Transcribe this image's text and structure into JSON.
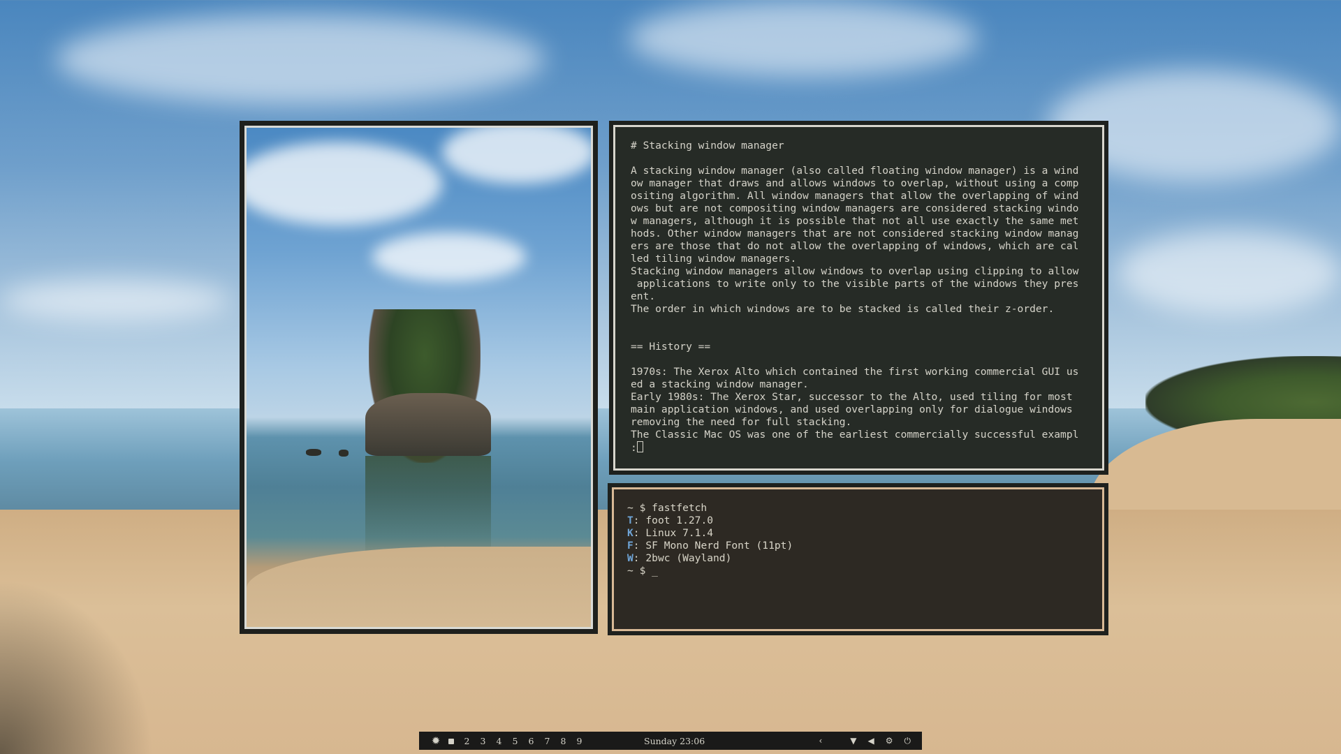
{
  "text_viewer": {
    "lines": [
      "# Stacking window manager",
      "",
      "A stacking window manager (also called floating window manager) is a wind",
      "ow manager that draws and allows windows to overlap, without using a comp",
      "ositing algorithm. All window managers that allow the overlapping of wind",
      "ows but are not compositing window managers are considered stacking windo",
      "w managers, although it is possible that not all use exactly the same met",
      "hods. Other window managers that are not considered stacking window manag",
      "ers are those that do not allow the overlapping of windows, which are cal",
      "led tiling window managers.",
      "Stacking window managers allow windows to overlap using clipping to allow",
      " applications to write only to the visible parts of the windows they pres",
      "ent.",
      "The order in which windows are to be stacked is called their z-order.",
      "",
      "",
      "== History ==",
      "",
      "1970s: The Xerox Alto which contained the first working commercial GUI us",
      "ed a stacking window manager.",
      "Early 1980s: The Xerox Star, successor to the Alto, used tiling for most",
      "main application windows, and used overlapping only for dialogue windows",
      "removing the need for full stacking.",
      "The Classic Mac OS was one of the earliest commercially successful exampl"
    ],
    "prompt": ":"
  },
  "terminal": {
    "command_line": "~ $ fastfetch",
    "info": [
      {
        "key": "T",
        "value": ": foot 1.27.0"
      },
      {
        "key": "K",
        "value": ": Linux 7.1.4"
      },
      {
        "key": "F",
        "value": ": SF Mono Nerd Font (11pt)"
      },
      {
        "key": "W",
        "value": ": 2bwc (Wayland)"
      }
    ],
    "prompt_line": "~ $ _",
    "key_color": "#6fa5d8"
  },
  "taskbar": {
    "launcher_icon": "gear-icon",
    "workspaces": [
      "2",
      "3",
      "4",
      "5",
      "6",
      "7",
      "8",
      "9"
    ],
    "clock": "Sunday 23:06",
    "tray": {
      "back": "‹",
      "wifi": "▼",
      "volume": "◀",
      "settings": "⚙",
      "power": "⏻"
    }
  }
}
